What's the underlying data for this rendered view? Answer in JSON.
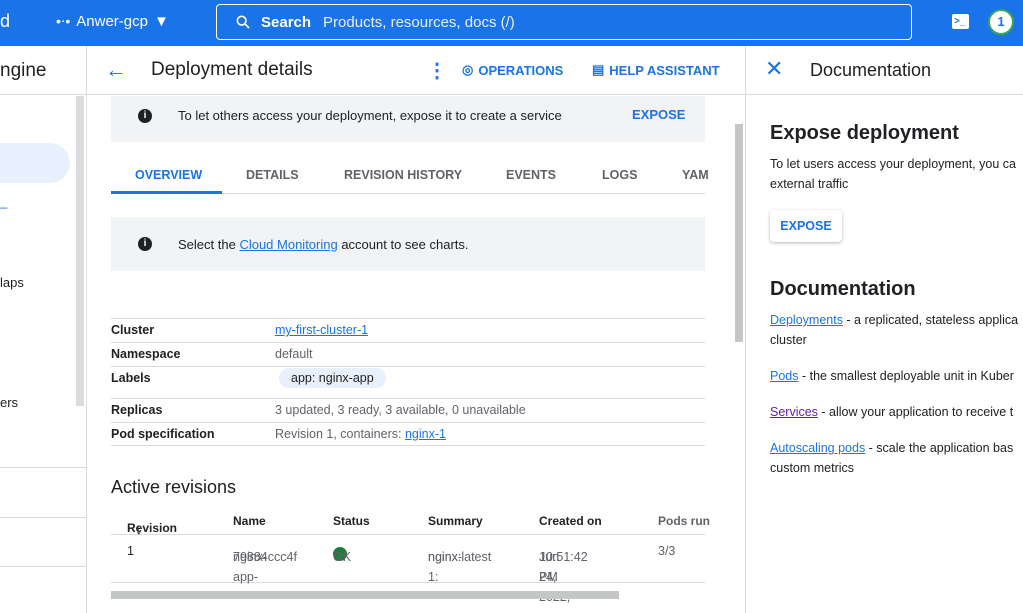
{
  "topbar": {
    "brand_fragment": "d",
    "project": "Anwer-gcp",
    "search_label": "Search",
    "search_placeholder": "Products, resources, docs (/)",
    "avatar": "1"
  },
  "leftnav": {
    "title_fragment": "ngine",
    "items": [
      "laps",
      "ers"
    ]
  },
  "header": {
    "title": "Deployment details",
    "operations": "OPERATIONS",
    "help": "HELP ASSISTANT"
  },
  "banner": {
    "text": "To let others access your deployment, expose it to create a service",
    "button": "EXPOSE"
  },
  "tabs": [
    "OVERVIEW",
    "DETAILS",
    "REVISION HISTORY",
    "EVENTS",
    "LOGS",
    "YAM"
  ],
  "monitoring": {
    "before": "Select the ",
    "link": "Cloud Monitoring",
    "after": " account to see charts."
  },
  "properties": {
    "cluster_label": "Cluster",
    "cluster_value": "my-first-cluster-1",
    "namespace_label": "Namespace",
    "namespace_value": "default",
    "labels_label": "Labels",
    "labels_value": "app: nginx-app",
    "replicas_label": "Replicas",
    "replicas_value": "3 updated, 3 ready, 3 available, 0 unavailable",
    "podspec_label": "Pod specification",
    "podspec_prefix": "Revision 1, containers: ",
    "podspec_link": "nginx-1"
  },
  "active_revisions": {
    "title": "Active revisions",
    "headers": [
      "Revision",
      "Name",
      "Status",
      "Summary",
      "Created on",
      "Pods run"
    ],
    "rows": [
      {
        "revision": "1",
        "name_line1": "nginx-app-",
        "name_line2": "79884ccc4f",
        "status": "OK",
        "summary_line1": "nginx-1:",
        "summary_line2": "nginx:latest",
        "created_line1": "Jun 24, 2022,",
        "created_line2": "10:51:42 PM",
        "pods": "3/3"
      }
    ]
  },
  "docs": {
    "title": "Documentation",
    "expose_heading": "Expose deployment",
    "expose_line1": "To let users access your deployment, you ca",
    "expose_line2": "external traffic",
    "expose_button": "EXPOSE",
    "doc_heading": "Documentation",
    "links": [
      {
        "link": "Deployments",
        "line1": " - a replicated, stateless applica",
        "line2": "cluster"
      },
      {
        "link": "Pods",
        "line1": " - the smallest deployable unit in Kuber",
        "line2": ""
      },
      {
        "link": "Services",
        "line1": " - allow your application to receive t",
        "line2": ""
      },
      {
        "link": "Autoscaling pods",
        "line1": " - scale the application bas",
        "line2": "custom metrics"
      }
    ]
  }
}
